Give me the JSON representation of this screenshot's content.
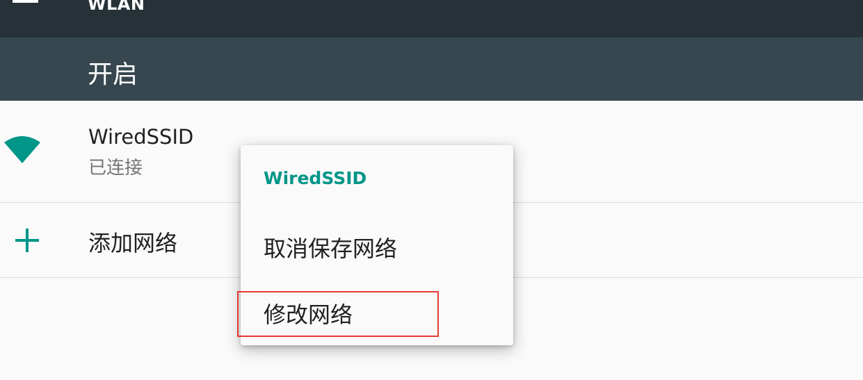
{
  "app_bar": {
    "title": "WLAN",
    "menu_icon": "hamburger-menu-icon",
    "background": "#263238"
  },
  "switch_bar": {
    "label": "开启",
    "background": "#37474f"
  },
  "networks": [
    {
      "name": "WiredSSID",
      "status": "已连接",
      "icon": "wifi-signal-icon",
      "icon_color": "#009688"
    }
  ],
  "add_network": {
    "label": "添加网络",
    "icon": "plus-icon",
    "icon_color": "#009688"
  },
  "context_menu": {
    "title": "WiredSSID",
    "title_color": "#009688",
    "items": [
      {
        "label": "取消保存网络"
      },
      {
        "label": "修改网络",
        "highlighted": true
      }
    ]
  },
  "highlight_color": "#e53935"
}
